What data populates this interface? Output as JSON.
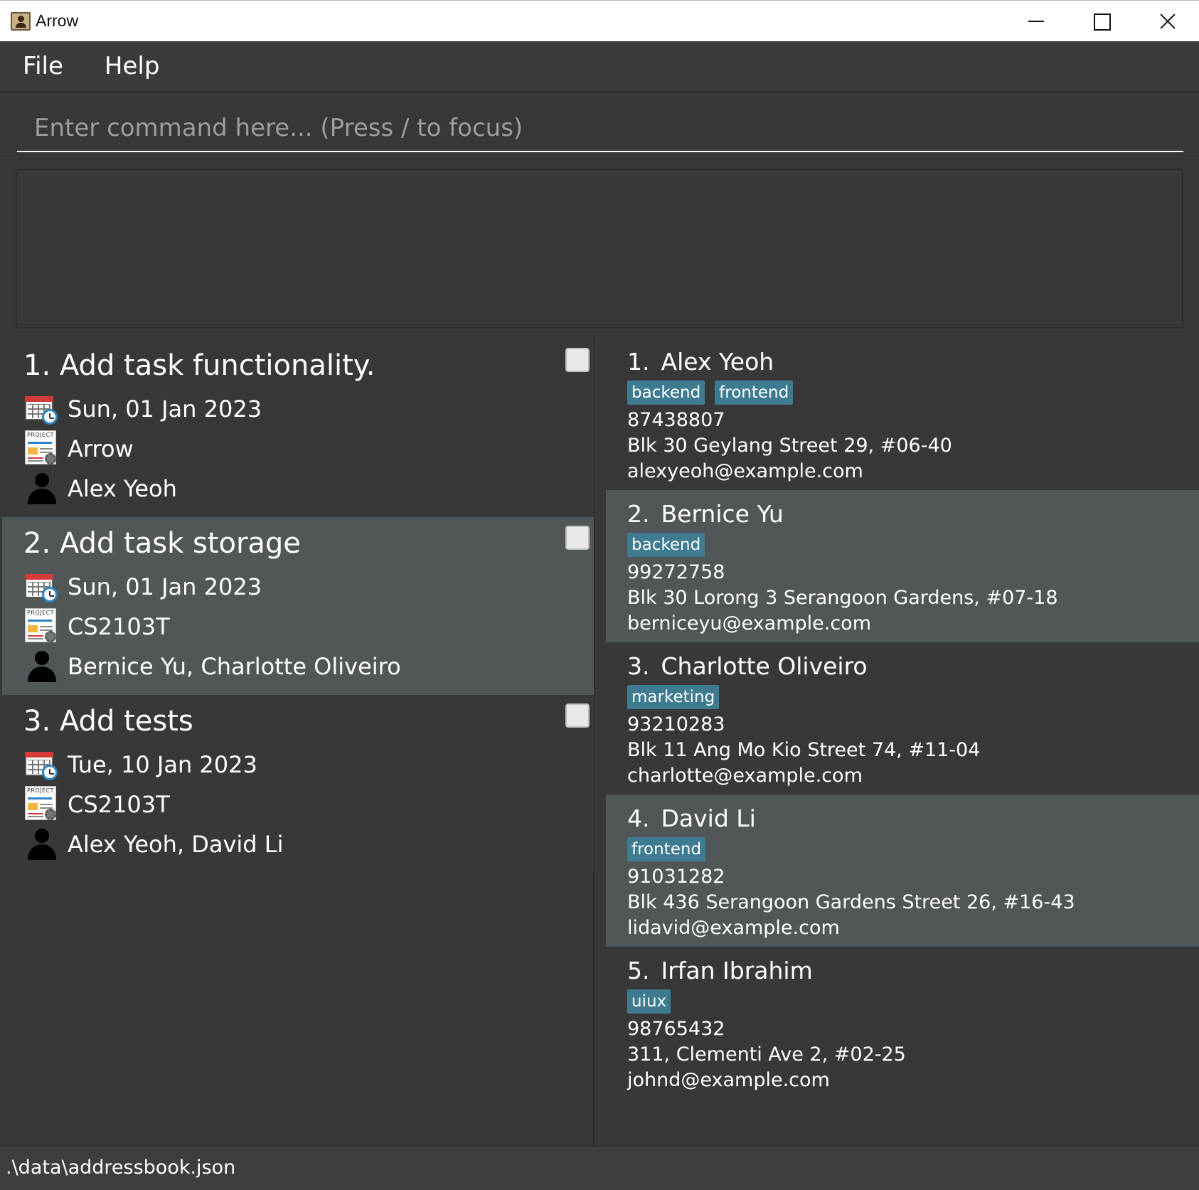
{
  "window": {
    "title": "Arrow"
  },
  "menu": {
    "items": [
      "File",
      "Help"
    ]
  },
  "command": {
    "placeholder": "Enter command here... (Press / to focus)",
    "value": ""
  },
  "result": {
    "text": ""
  },
  "tasks": [
    {
      "title": "1. Add task functionality.",
      "date": "Sun, 01 Jan 2023",
      "project": "Arrow",
      "assignees": "Alex Yeoh"
    },
    {
      "title": "2. Add task storage",
      "date": "Sun, 01 Jan 2023",
      "project": "CS2103T",
      "assignees": "Bernice Yu, Charlotte Oliveiro"
    },
    {
      "title": "3. Add tests",
      "date": "Tue, 10 Jan 2023",
      "project": "CS2103T",
      "assignees": "Alex Yeoh, David Li"
    }
  ],
  "persons": [
    {
      "index": "1.",
      "name": "Alex Yeoh",
      "tags": [
        "backend",
        "frontend"
      ],
      "phone": "87438807",
      "address": "Blk 30 Geylang Street 29, #06-40",
      "email": "alexyeoh@example.com"
    },
    {
      "index": "2.",
      "name": "Bernice Yu",
      "tags": [
        "backend"
      ],
      "phone": "99272758",
      "address": "Blk 30 Lorong 3 Serangoon Gardens, #07-18",
      "email": "berniceyu@example.com"
    },
    {
      "index": "3.",
      "name": "Charlotte Oliveiro",
      "tags": [
        "marketing"
      ],
      "phone": "93210283",
      "address": "Blk 11 Ang Mo Kio Street 74, #11-04",
      "email": "charlotte@example.com"
    },
    {
      "index": "4.",
      "name": "David Li",
      "tags": [
        "frontend"
      ],
      "phone": "91031282",
      "address": "Blk 436 Serangoon Gardens Street 26, #16-43",
      "email": "lidavid@example.com"
    },
    {
      "index": "5.",
      "name": "Irfan Ibrahim",
      "tags": [
        "uiux"
      ],
      "phone": "98765432",
      "address": "311, Clementi Ave 2, #02-25",
      "email": "johnd@example.com"
    }
  ],
  "status": {
    "path": ".\\data\\addressbook.json"
  },
  "colors": {
    "background": "#383838",
    "alt_row": "#515658",
    "tag": "#3e7b91"
  },
  "icons": {
    "date": "calendar-clock-icon",
    "project": "project-sheet-icon",
    "assignee": "person-icon"
  }
}
